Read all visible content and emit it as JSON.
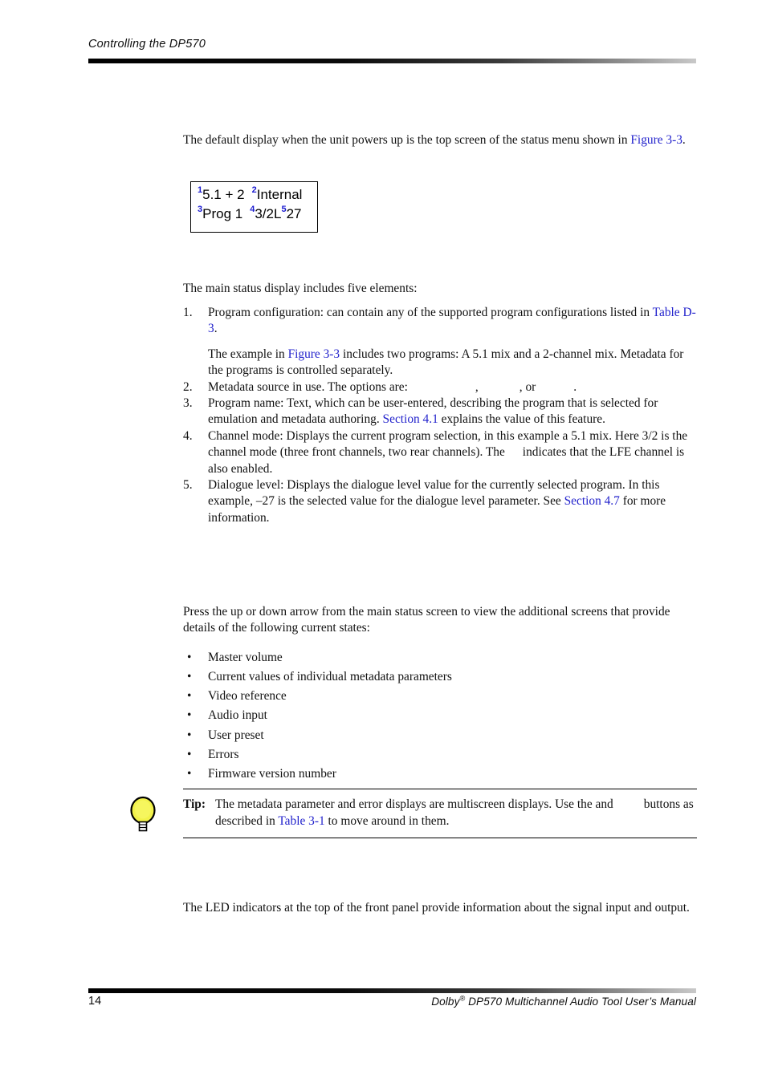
{
  "header": {
    "running_title": "Controlling the DP570"
  },
  "intro": {
    "paragraph_part1": "The default display when the unit powers up is the top screen of the status menu shown in ",
    "figure_link": "Figure 3-3",
    "paragraph_part2": "."
  },
  "figure": {
    "name": "lcd-status-display",
    "callouts": [
      "1",
      "2",
      "3",
      "4",
      "5"
    ],
    "line1_item1": "5.1 + 2",
    "line1_item2": "Internal",
    "line2_item3": "Prog 1",
    "line2_item4": "3/2L",
    "line2_item5": "27"
  },
  "elements_section": {
    "intro": "The main status display includes five elements:",
    "items": [
      {
        "marker": "1.",
        "text_part1": "Program configuration: can contain any of the supported program configurations listed in ",
        "link": "Table D-3",
        "text_part2": ".",
        "sub_part1": "The example in ",
        "sub_link": "Figure 3-3",
        "sub_part2": " includes two programs: A 5.1 mix and a 2-channel mix. Metadata for the programs is controlled separately."
      },
      {
        "marker": "2.",
        "text_part1": "Metadata source in use. The options are:",
        "text_part2": ",",
        "text_part3": ", or",
        "text_part4": "."
      },
      {
        "marker": "3.",
        "text_part1": "Program name: Text, which can be user-entered, describing the program that is selected for emulation and metadata authoring. ",
        "link": "Section 4.1",
        "text_part2": " explains the value of this feature."
      },
      {
        "marker": "4.",
        "text_part1": "Channel mode: Displays the current program selection, in this example a 5.1 mix. Here 3/2 is the channel mode (three front channels, two rear channels). The",
        "text_part2": "indicates that the LFE channel is also enabled."
      },
      {
        "marker": "5.",
        "text_part1": "Dialogue level: Displays the dialogue level value for the currently selected program. In this example, –27 is the selected value for the dialogue level parameter. See ",
        "link": "Section 4.7",
        "text_part2": " for more information."
      }
    ]
  },
  "states_section": {
    "paragraph": "Press the up or down arrow from the main status screen to view the additional screens that provide details of the following current states:",
    "bullet_char": "•",
    "bullets": [
      "Master volume",
      "Current values of individual metadata parameters",
      "Video reference",
      "Audio input",
      "User preset",
      "Errors",
      "Firmware version number"
    ]
  },
  "tip": {
    "icon": "lightbulb-icon",
    "label": "Tip:",
    "line1": "The metadata parameter and error displays are multiscreen displays. Use the",
    "line2_before": "and",
    "line2_mid": "buttons as described in ",
    "link": "Table 3-1",
    "line2_after": " to move around in them."
  },
  "led_section": {
    "paragraph": "The LED indicators at the top of the front panel provide information about the signal input and output."
  },
  "footer": {
    "page_number": "14",
    "manual_prefix": "Dolby",
    "manual_sup": "®",
    "manual_suffix": " DP570 Multichannel Audio Tool User’s Manual"
  },
  "colors": {
    "link_blue": "#2222cc",
    "callout_blue": "#1a1ad0",
    "bulb_yellow": "#f2f24a",
    "text_black": "#111111"
  }
}
